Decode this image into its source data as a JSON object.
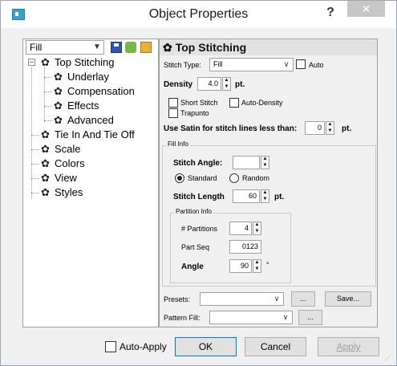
{
  "window": {
    "title": "Object Properties",
    "help_label": "?",
    "close_label": "✕"
  },
  "left": {
    "dropdown_value": "Fill",
    "tree": [
      {
        "label": "Top Stitching",
        "level": 0,
        "expander": "−"
      },
      {
        "label": "Underlay",
        "level": 1
      },
      {
        "label": "Compensation",
        "level": 1
      },
      {
        "label": "Effects",
        "level": 1
      },
      {
        "label": "Advanced",
        "level": 1
      },
      {
        "label": "Tie In And Tie Off",
        "level": 0
      },
      {
        "label": "Scale",
        "level": 0
      },
      {
        "label": "Colors",
        "level": 0
      },
      {
        "label": "View",
        "level": 0
      },
      {
        "label": "Styles",
        "level": 0
      }
    ]
  },
  "right": {
    "header": "Top Stitching",
    "stitch_type_label": "Stitch Type:",
    "stitch_type_value": "Fill",
    "auto_label": "Auto",
    "density_label": "Density",
    "density_value": "4.0",
    "density_unit": "pt.",
    "short_stitch_label": "Short Stitch",
    "auto_density_label": "Auto-Density",
    "trapunto_label": "Trapunto",
    "satin_label": "Use Satin for stitch lines less than:",
    "satin_value": "0",
    "satin_unit": "pt.",
    "fill_info_title": "Fill Info",
    "stitch_angle_label": "Stitch Angle:",
    "stitch_angle_value": "",
    "standard_label": "Standard",
    "random_label": "Random",
    "stitch_length_label": "Stitch Length",
    "stitch_length_value": "60",
    "stitch_length_unit": "pt.",
    "partition_title": "Partition Info",
    "partitions_label": "# Partitions",
    "partitions_value": "4",
    "part_seq_label": "Part Seq",
    "part_seq_value": "0123",
    "angle_label": "Angle",
    "angle_value": "90",
    "angle_unit": "°",
    "presets_label": "Presets:",
    "presets_value": "",
    "presets_browse": "...",
    "save_label": "Save...",
    "pattern_fill_label": "Pattern Fill:",
    "pattern_fill_value": "",
    "pattern_browse": "..."
  },
  "footer": {
    "auto_apply_label": "Auto-Apply",
    "ok_label": "OK",
    "cancel_label": "Cancel",
    "apply_label": "Apply"
  },
  "icons": {
    "gear": "✿"
  }
}
